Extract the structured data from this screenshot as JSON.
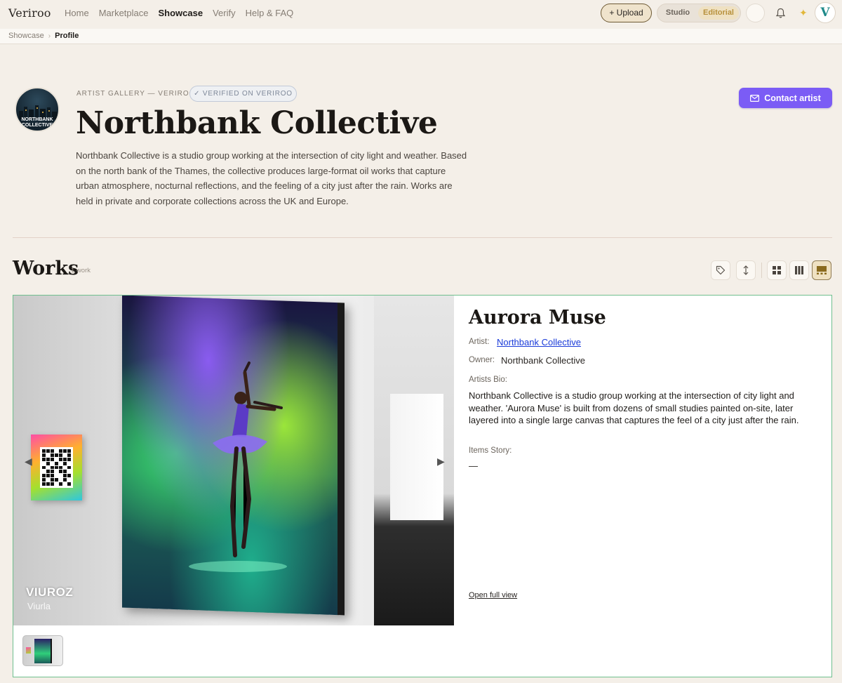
{
  "app": {
    "brand": "Veriroo"
  },
  "nav": {
    "links": [
      "Home",
      "Marketplace",
      "Showcase",
      "Verify",
      "Help & FAQ"
    ],
    "active": "Showcase",
    "upload_label": "+ Upload",
    "mode_studio": "Studio",
    "mode_editorial": "Editorial",
    "avatar_letter": "V"
  },
  "breadcrumb": {
    "items": [
      "Showcase",
      "Profile"
    ]
  },
  "profile": {
    "avatar_text": "NORTHBANK COLLECTIVE",
    "eyebrow": "ARTIST GALLERY — VERIROO",
    "verified_label": "VERIFIED ON VERIROO",
    "name": "Northbank Collective",
    "bio": "Northbank Collective is a studio group working at the intersection of city light and weather. Based on the north bank of the Thames, the collective produces large-format oil works that capture urban atmosphere, nocturnal reflections, and the feeling of a city just after the rain. Works are held in private and corporate collections across the UK and Europe.",
    "contact_label": "Contact artist"
  },
  "works": {
    "title": "Works",
    "count": "1 work",
    "items": [
      {
        "title": "Aurora Muse",
        "artist_label": "Artist:",
        "artist": "Northbank Collective",
        "owner_label": "Owner:",
        "owner": "Northbank Collective",
        "bio_label": "Artists Bio:",
        "bio": "Northbank Collective is a studio group working at the intersection of city light and weather. 'Aurora Muse' is built from dozens of small studies painted on-site, later layered into a single large canvas that captures the feel of a city just after the rain.",
        "story_label": "Items Story:",
        "story": "—",
        "full_view_label": "Open full view",
        "image_brand_1": "VIUROZ",
        "image_brand_2": "Viurla"
      }
    ]
  },
  "colors": {
    "background": "#f4efe8",
    "accent_purple": "#7b5cf5",
    "card_border": "#6fbf8e",
    "link_blue": "#1a3bd9",
    "editorial_gold": "#b8913c"
  },
  "icons": {
    "theme_toggle": "moon-icon",
    "notifications": "bell-icon",
    "sparkle": "sparkle-icon",
    "contact": "mail-icon",
    "filter_tags": "tag-icon",
    "sort": "sort-arrows-icon",
    "grid_view": "grid-icon",
    "columns_view": "columns-icon",
    "editorial_view": "editorial-view-icon"
  }
}
